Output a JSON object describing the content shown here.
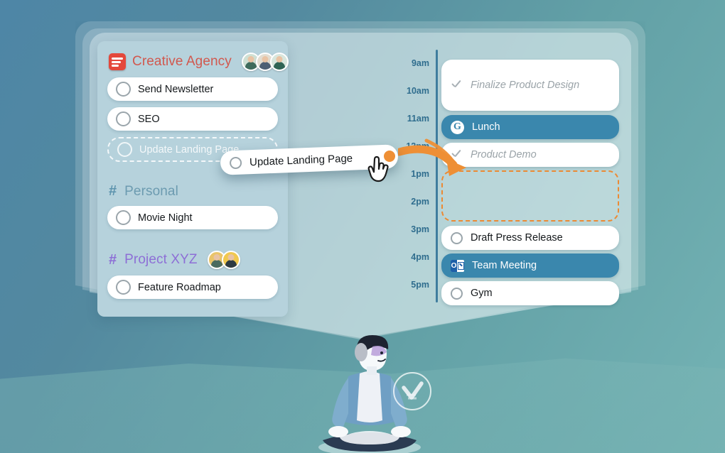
{
  "app": {
    "background_gradient_from": "#4e86a6",
    "background_gradient_to": "#74b3b4",
    "accent_orange": "#ec8a33",
    "accent_blue": "#3a87ad"
  },
  "task_list": {
    "projects": [
      {
        "name": "Creative Agency",
        "icon": "todoist-logo",
        "color": "#d1584e",
        "members": 3,
        "tasks": [
          {
            "label": "Send Newsletter",
            "state": "open"
          },
          {
            "label": "SEO",
            "state": "open"
          },
          {
            "label": "Update Landing Page",
            "state": "dragging-placeholder"
          }
        ]
      },
      {
        "name": "Personal",
        "icon": "hash-icon",
        "color": "#6c9bb0",
        "members": 0,
        "tasks": [
          {
            "label": "Movie Night",
            "state": "open"
          }
        ]
      },
      {
        "name": "Project XYZ",
        "icon": "hash-icon",
        "color": "#8d6fd6",
        "members": 2,
        "tasks": [
          {
            "label": "Feature Roadmap",
            "state": "open"
          }
        ]
      }
    ]
  },
  "calendar": {
    "time_labels": [
      "9am",
      "10am",
      "11am",
      "12pm",
      "1pm",
      "2pm",
      "3pm",
      "4pm",
      "5pm"
    ],
    "events": [
      {
        "label": "Finalize Product Design",
        "style": "white",
        "icon": "check-icon",
        "state": "completed"
      },
      {
        "label": "Lunch",
        "style": "blue",
        "icon": "google-icon",
        "state": "scheduled"
      },
      {
        "label": "Product Demo",
        "style": "white",
        "icon": "check-icon",
        "state": "completed"
      },
      {
        "label": "",
        "style": "dropzone",
        "icon": "none",
        "state": "drop-target"
      },
      {
        "label": "Draft Press Release",
        "style": "white",
        "icon": "circle-icon",
        "state": "open"
      },
      {
        "label": "Team Meeting",
        "style": "blue",
        "icon": "outlook-icon",
        "state": "scheduled"
      },
      {
        "label": "Gym",
        "style": "white",
        "icon": "circle-icon",
        "state": "open"
      }
    ]
  },
  "drag": {
    "card_label": "Update Landing Page",
    "cursor": "pointing-hand-cursor",
    "arrow": "curved-drag-arrow"
  },
  "illustration": {
    "figure": "meditating-person",
    "badge": "checkmark-circle-logo"
  }
}
